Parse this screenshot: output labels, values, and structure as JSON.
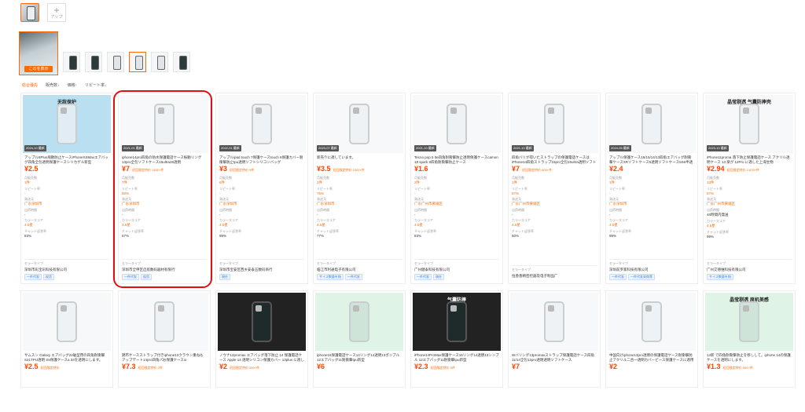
{
  "toolbar": {
    "add_label": "アップ"
  },
  "sort_tabs": [
    "総合優先",
    "販売数↓",
    "価格↑",
    "リピート率↓"
  ],
  "gallery": {
    "main_tag": "このを表示"
  },
  "labels": {
    "sales": "月販売数",
    "repeat": "リピート率",
    "origin": "発送元",
    "timing": "出荷時間",
    "color": "カラースコア",
    "rating": "チャット返答率",
    "shop": "セラータイプ"
  },
  "products_row1": [
    {
      "badge": "2024-10 最新",
      "title": "アップル8Plus飛散防止ケースiPhoneXSMaxエアバッグ四角全包透明保護ケースシリカゲル新型",
      "price": "¥2.5",
      "sub": "",
      "sales": "1件",
      "repeat": "-",
      "origin": "广东深圳市",
      "timing": "-",
      "color": "4.5星",
      "rate": "83%",
      "shop": "深圳市彩宝讯科技有限公司",
      "chips": [
        "一件代发",
        "现货"
      ],
      "img": "blue",
      "ad": "无敌保护"
    },
    {
      "badge": "2021-01 最新",
      "title": "iphone14pro四角の防水保護電話ケース振動リング13pro全包ソフトケース15ultra28透明",
      "price": "¥7",
      "sub": "初回限定特价 1400+件",
      "sales": "7件",
      "repeat": "50%",
      "origin": "广东深圳市",
      "timing": "-",
      "color": "3.5星",
      "rate": "67%",
      "shop": "深圳市全申区启航数码器材有限行",
      "chips": [
        "一件代发",
        "现货"
      ],
      "img": "",
      "ad": ""
    },
    {
      "badge": "2022-01 最新",
      "title": "アップルipad touch 7保護ケースtouch 6保護カバー耐衝撃防止tpu透明ソフトシリコンバッグ",
      "price": "¥3",
      "sub": "初回限定特价 5件",
      "sales": "6件",
      "repeat": "-",
      "origin": "广东深圳市",
      "timing": "-",
      "color": "4.5星",
      "rate": "98%",
      "shop": "深圳市宝安区西乡安泰五数码商行",
      "chips": [
        "現在"
      ],
      "img": "",
      "ad": ""
    },
    {
      "badge": "2023-07 最新",
      "title": "新売りに適しています。",
      "price": "¥3.5",
      "sub": "初回限定特价 1500+件",
      "sales": "2件",
      "repeat": "75%",
      "origin": "广东深圳市",
      "timing": "-",
      "color": "4.5星",
      "rate": "77%",
      "shop": "临江市利通电子有限公司",
      "chips": [
        "サイズ数量を指",
        "一件代发"
      ],
      "img": "",
      "ad": ""
    },
    {
      "badge": "2021-10 最新",
      "title": "Tecno pop 5 lte四角耐衝撃防止透明保護ケースcamon 18 spark 8四角耐衝撃防止ケース",
      "price": "¥1.6",
      "sub": "",
      "sales": "2件",
      "repeat": "-",
      "origin": "广东广州市黄埔区",
      "timing": "-",
      "color": "4.5星",
      "rate": "83%",
      "shop": "广州健泰科技有限公司",
      "chips": [
        "一件代发",
        "現在"
      ],
      "img": "",
      "ad": ""
    },
    {
      "badge": "2021-10 最新",
      "title": "四角バリが得いたストラップの保護電話ケースはiPhone14四角ストラップ15pro全包15ultra透明ソフトケ…",
      "price": "¥7",
      "sub": "初回限定特价 800+件",
      "sales": "1件",
      "repeat": "67%",
      "origin": "广东广州市黄埔区",
      "timing": "-",
      "color": "4.5星",
      "rate": "50%",
      "shop": "恒香香精密控器及电子制品厂",
      "chips": [],
      "img": "",
      "ad": ""
    },
    {
      "badge": "2024-05 最新",
      "title": "アップル保護ケース16/15/14/13四角エアバッグ耐衝撃ケースXRソフトケース5透明ソフトケース5S6半透明",
      "price": "¥2.4",
      "sub": "",
      "sales": "1件",
      "repeat": "-",
      "origin": "广东深圳市",
      "timing": "-",
      "color": "4.5星",
      "rate": "98%",
      "shop": "深圳前罗家科技有限公司",
      "chips": [
        "一件代发",
        "一件代发采购等"
      ],
      "img": "",
      "ad": ""
    },
    {
      "badge": "2023-10 最新",
      "title": "iPhone11proma 落下防止保護電話ケース アクリル透明ケース 13 楽が 12Pro に適した上海生物",
      "price": "¥2.94",
      "sub": "初回限定特价 2,875+件",
      "sales": "13件",
      "repeat": "67%",
      "origin": "广东广州市黄埔区",
      "timing": "48時間内発送",
      "color": "4.5星",
      "rate": "99%",
      "shop": "广州艾德维科技有限公司",
      "chips": [
        "サイズ数量を指"
      ],
      "img": "",
      "ad": "晶莹剔透 气囊防摔壳"
    }
  ],
  "products_row2": [
    {
      "title": "サムスン Galaxy エアバッグ22破型用の四角耐衝撃S21TPU透明 S5保護ケースa 33を透明にします。",
      "price": "¥2.5",
      "sub": "初回限定特价",
      "ad": "",
      "img": ""
    },
    {
      "title": "錦市ケースストラップ付きiphone13クラウン重ねもアップデート14pro四角パお保護ケースio",
      "price": "¥7.3",
      "sub": "初回限定特价 2件",
      "ad": "",
      "img": ""
    },
    {
      "title": "ノウナ12promax エアバッグ落下防止 14 保護電話ケース Apple 14 透明シリコン保護カバー 13plus に適しています…",
      "price": "¥2",
      "sub": "初回限定特价 500+件",
      "ad": "",
      "img": "dark"
    },
    {
      "title": "iphone16保護電話ケース14リング14透明13ポンプル 12エアバッグ11耐衝撃tpu新型",
      "price": "¥6",
      "sub": "",
      "ad": "",
      "img": "green"
    },
    {
      "title": "iPhone14ProMax保護ケース16リング14透明13シンプル 12エアバッグ11耐衝撃tpu新型",
      "price": "¥2.3",
      "sub": "初回限定特价 5件",
      "ad": "气囊防摔",
      "img": "dark"
    },
    {
      "title": "Wバリング13promaxストラップ保護電話ケース四角11/14全包12pro透明透明ソフトケース",
      "price": "¥7",
      "sub": "",
      "ad": "",
      "img": ""
    },
    {
      "title": "中国向けiphone13pro透明の保護電話ケース耐衝撃防止アクリル二合一透明カバーピース保護ケースに適用される",
      "price": "¥2",
      "sub": "",
      "ad": "",
      "img": ""
    },
    {
      "title": "13新 で四角耐衝撃防止を移しして。iphone 14の保護ケースを透明にします。",
      "price": "¥1.3",
      "sub": "初回限定特价 500+件",
      "ad": "晶莹剔透 原机美感",
      "img": "green"
    }
  ]
}
